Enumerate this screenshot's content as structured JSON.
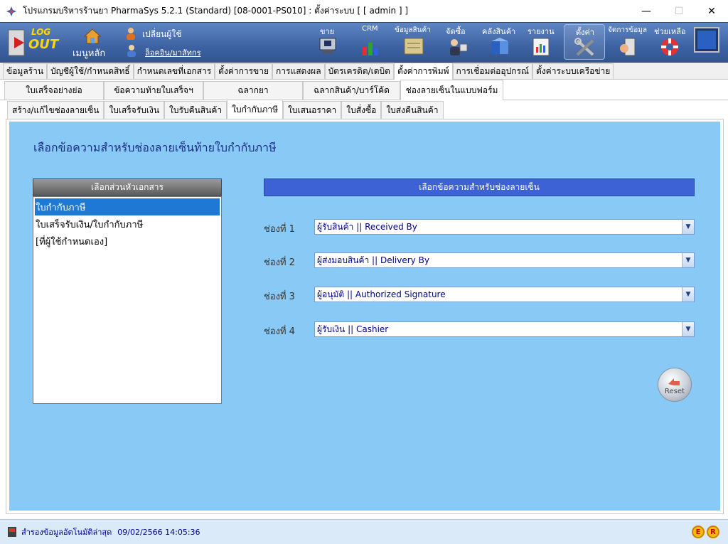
{
  "window": {
    "title": "โปรแกรมบริหารร้านยา PharmaSys 5.2.1 (Standard) [08-0001-PS010] : ตั้งค่าระบบ  [ [ admin ] ]",
    "minimize": "—",
    "maximize": "☐",
    "close": "✕"
  },
  "toolbar": {
    "logout_top": "LOG",
    "logout_bottom": "OUT",
    "main_menu": "เมนูหลัก",
    "change_user": "เปลี่ยนผู้ใช้",
    "login_other": "ล็อคอิน/มาสัทกร",
    "items": [
      {
        "label": "ขาย",
        "icon": "sale-icon"
      },
      {
        "label": "CRM",
        "icon": "crm-icon"
      },
      {
        "label": "ข้อมูลสินค้า",
        "icon": "product-data-icon"
      },
      {
        "label": "จัดซื้อ",
        "icon": "purchase-icon"
      },
      {
        "label": "คลังสินค้า",
        "icon": "warehouse-icon"
      },
      {
        "label": "รายงาน",
        "icon": "report-icon"
      },
      {
        "label": "ตั้งค่า",
        "icon": "settings-tools-icon"
      },
      {
        "label": "จัดการข้อมูล",
        "icon": "data-management-icon"
      },
      {
        "label": "ช่วยเหลือ",
        "icon": "help-lifebuoy-icon"
      }
    ]
  },
  "tabs_level1": [
    {
      "label": "ข้อมูลร้าน",
      "active": false
    },
    {
      "label": "บัญชีผู้ใช้/กำหนดสิทธิ์",
      "active": false
    },
    {
      "label": "กำหนดเลขที่เอกสาร",
      "active": false
    },
    {
      "label": "ตั้งค่าการขาย",
      "active": false
    },
    {
      "label": "การแสดงผล",
      "active": false
    },
    {
      "label": "บัตรเครดิต/เดบิต",
      "active": false
    },
    {
      "label": "ตั้งค่าการพิมพ์",
      "active": true
    },
    {
      "label": "การเชื่อมต่ออุปกรณ์",
      "active": false
    },
    {
      "label": "ตั้งค่าระบบเครือข่าย",
      "active": false
    }
  ],
  "tabs_level2": [
    {
      "label": "ใบเสร็จอย่างย่อ",
      "active": false
    },
    {
      "label": "ข้อความท้ายใบเสร็จฯ",
      "active": false
    },
    {
      "label": "ฉลากยา",
      "active": false
    },
    {
      "label": "ฉลากสินค้า/บาร์โค้ด",
      "active": false
    },
    {
      "label": "ช่องลายเซ็นในแบบฟอร์ม",
      "active": true
    }
  ],
  "tabs_level3": [
    {
      "label": "สร้าง/แก้ไขช่องลายเซ็น",
      "active": false
    },
    {
      "label": "ใบเสร็จรับเงิน",
      "active": false
    },
    {
      "label": "ใบรับคืนสินค้า",
      "active": false
    },
    {
      "label": "ใบกำกับภาษี",
      "active": true
    },
    {
      "label": "ใบเสนอราคา",
      "active": false
    },
    {
      "label": "ใบสั่งซื้อ",
      "active": false
    },
    {
      "label": "ใบส่งคืนสินค้า",
      "active": false
    }
  ],
  "page": {
    "title": "เลือกข้อความสำหรับช่องลายเซ็นท้ายใบกำกับภาษี",
    "list_header": "เลือกส่วนหัวเอกสาร",
    "list_items": [
      {
        "label": "ใบกำกับภาษี",
        "selected": true
      },
      {
        "label": "ใบเสร็จรับเงิน/ใบกำกับภาษี",
        "selected": false
      },
      {
        "label": "[ที่ผู้ใช้กำหนดเอง]",
        "selected": false
      }
    ],
    "right_header": "เลือกข้อความสำหรับช่องลายเซ็น",
    "slots": [
      {
        "label": "ช่องที่ 1",
        "value": "ผู้รับสินค้า || Received By"
      },
      {
        "label": "ช่องที่ 2",
        "value": "ผู้ส่งมอบสินค้า || Delivery By"
      },
      {
        "label": "ช่องที่ 3",
        "value": "ผู้อนุมัติ || Authorized Signature"
      },
      {
        "label": "ช่องที่ 4",
        "value": "ผู้รับเงิน || Cashier"
      }
    ],
    "reset_label": "Reset"
  },
  "status": {
    "text": "สำรองข้อมูลอัตโนมัติล่าสุด",
    "time": "09/02/2566 14:05:36",
    "icon_e": "E",
    "icon_r": "R"
  },
  "colors": {
    "panel_bg": "#88c9f6",
    "title_color": "#1a2e86",
    "header_blue": "#3d62d6",
    "selected_blue": "#1e78d6",
    "toolbar_blue": "#3d63a4"
  }
}
